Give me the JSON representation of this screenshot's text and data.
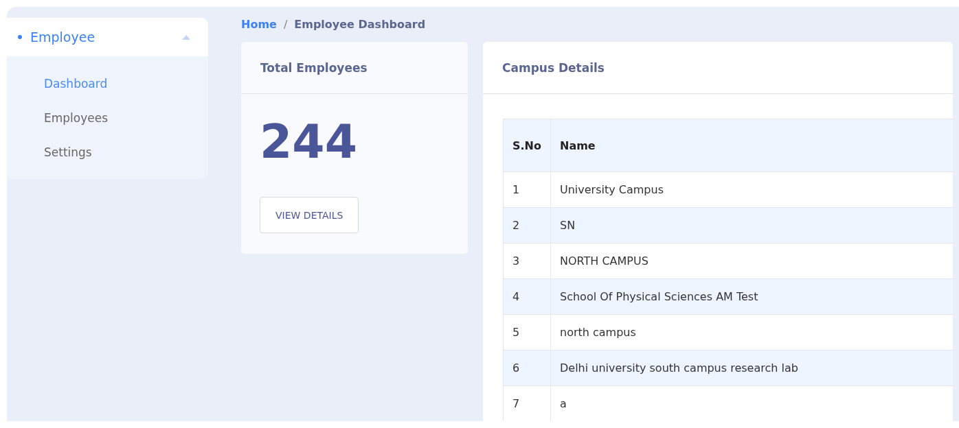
{
  "sidebar": {
    "group": {
      "label": "Employee",
      "expanded": true
    },
    "items": [
      {
        "label": "Dashboard",
        "selected": true
      },
      {
        "label": "Employees",
        "selected": false
      },
      {
        "label": "Settings",
        "selected": false
      }
    ]
  },
  "breadcrumb": [
    {
      "label": "Home",
      "kind": "link"
    },
    {
      "label": "/",
      "kind": "separator"
    },
    {
      "label": "Employee Dashboard",
      "kind": "current"
    }
  ],
  "stat_card": {
    "title": "Total Employees",
    "value": "244",
    "button": "VIEW DETAILS"
  },
  "campus_card": {
    "title": "Campus Details",
    "table": {
      "columns": [
        "S.No",
        "Name"
      ],
      "rows": [
        [
          "1",
          "University Campus"
        ],
        [
          "2",
          "SN"
        ],
        [
          "3",
          "NORTH CAMPUS"
        ],
        [
          "4",
          "School Of Physical Sciences AM Test"
        ],
        [
          "5",
          "north campus"
        ],
        [
          "6",
          "Delhi university south campus research lab"
        ],
        [
          "7",
          "a"
        ]
      ]
    }
  }
}
